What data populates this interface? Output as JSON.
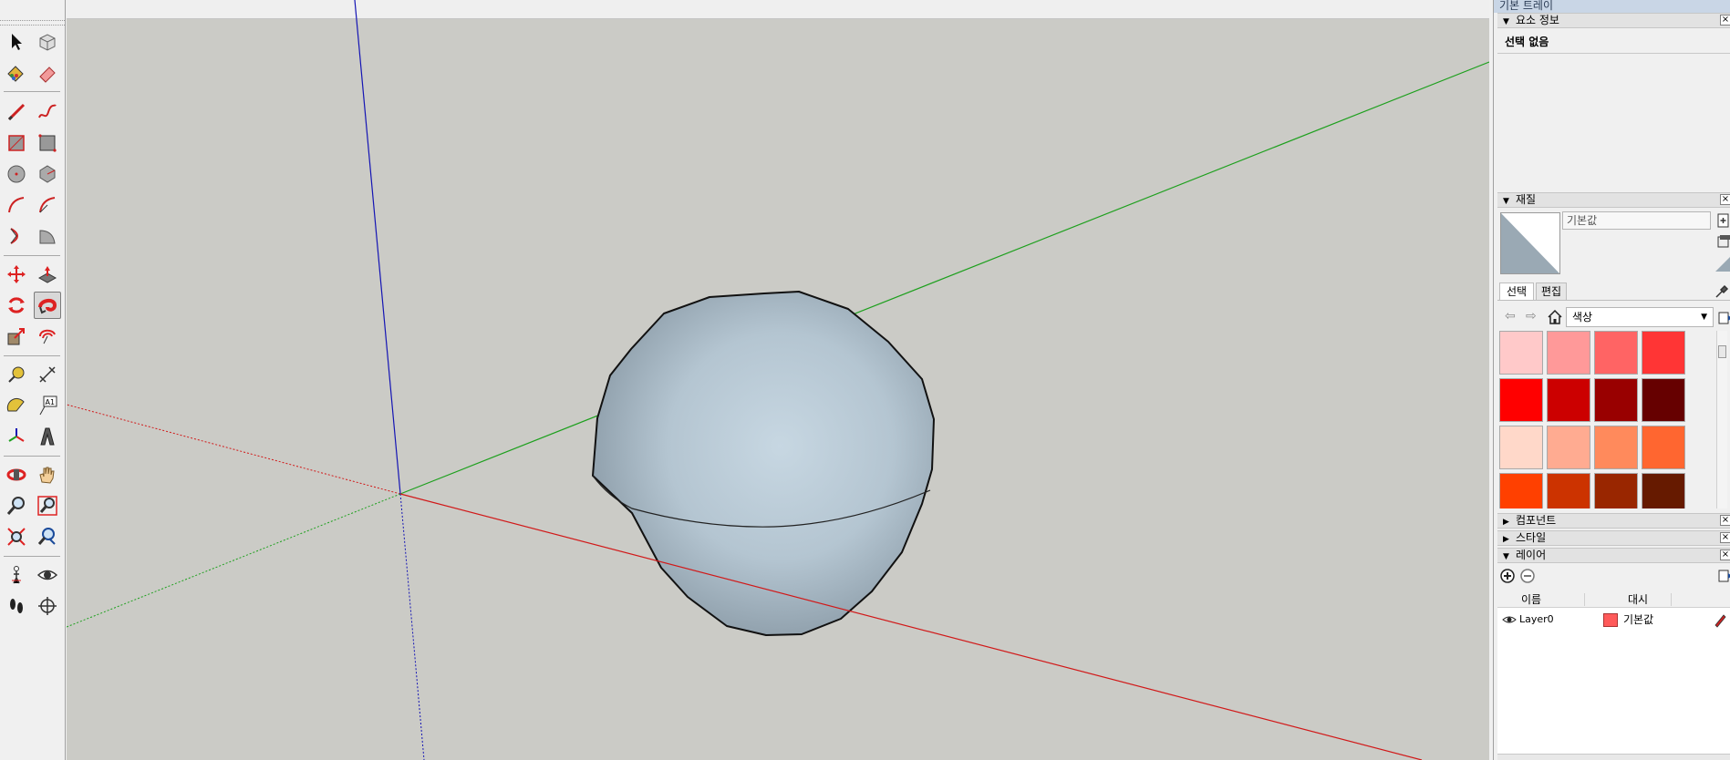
{
  "tools": [
    {
      "name": "select-tool-icon"
    },
    {
      "name": "make-component-icon"
    },
    {
      "name": "paint-bucket-icon"
    },
    {
      "name": "eraser-icon"
    },
    {
      "name": "line-tool-icon"
    },
    {
      "name": "freehand-icon"
    },
    {
      "name": "rectangle-icon"
    },
    {
      "name": "rotated-rectangle-icon"
    },
    {
      "name": "circle-icon"
    },
    {
      "name": "polygon-icon"
    },
    {
      "name": "arc-icon"
    },
    {
      "name": "two-point-arc-icon"
    },
    {
      "name": "three-point-arc-icon"
    },
    {
      "name": "pie-icon"
    },
    {
      "name": "move-icon"
    },
    {
      "name": "push-pull-icon"
    },
    {
      "name": "rotate-icon"
    },
    {
      "name": "follow-me-icon"
    },
    {
      "name": "scale-icon"
    },
    {
      "name": "offset-icon"
    },
    {
      "name": "tape-measure-icon"
    },
    {
      "name": "dimension-icon"
    },
    {
      "name": "protractor-icon"
    },
    {
      "name": "text-icon"
    },
    {
      "name": "axes-icon"
    },
    {
      "name": "3d-text-icon"
    },
    {
      "name": "orbit-icon"
    },
    {
      "name": "pan-icon"
    },
    {
      "name": "zoom-icon"
    },
    {
      "name": "zoom-window-icon"
    },
    {
      "name": "zoom-extents-icon"
    },
    {
      "name": "previous-view-icon"
    },
    {
      "name": "position-camera-icon"
    },
    {
      "name": "look-around-icon"
    },
    {
      "name": "walk-icon"
    },
    {
      "name": "section-plane-icon"
    }
  ],
  "active_tool": "follow-me-icon",
  "tray": {
    "title": "기본 트레이",
    "entity_info": {
      "header": "요소 정보",
      "status": "선택 없음"
    },
    "materials": {
      "header": "재질",
      "name_value": "기본값",
      "tabs": [
        "선택",
        "편집"
      ],
      "library": "색상",
      "swatches": [
        "#ffc9c9",
        "#ff9999",
        "#ff6464",
        "#ff3535",
        "#ff0000",
        "#cc0000",
        "#990000",
        "#660000",
        "#ffd8c9",
        "#ffab91",
        "#ff8a5c",
        "#ff6630",
        "#ff4000",
        "#cc3300",
        "#992600",
        "#661a00"
      ]
    },
    "components": {
      "header": "컴포넌트"
    },
    "styles": {
      "header": "스타일"
    },
    "layers": {
      "header": "레이어",
      "col_name": "이름",
      "col_dashes": "대시",
      "rows": [
        {
          "name": "Layer0",
          "color": "#ff5a5a",
          "color_label": "기본값"
        }
      ]
    }
  },
  "colors": {
    "viewport_bg": "#cbcbc6",
    "axis_red": "#d11919",
    "axis_green": "#1ea01e",
    "axis_blue": "#1414b4",
    "sphere_fill": "#b9c9d4"
  }
}
